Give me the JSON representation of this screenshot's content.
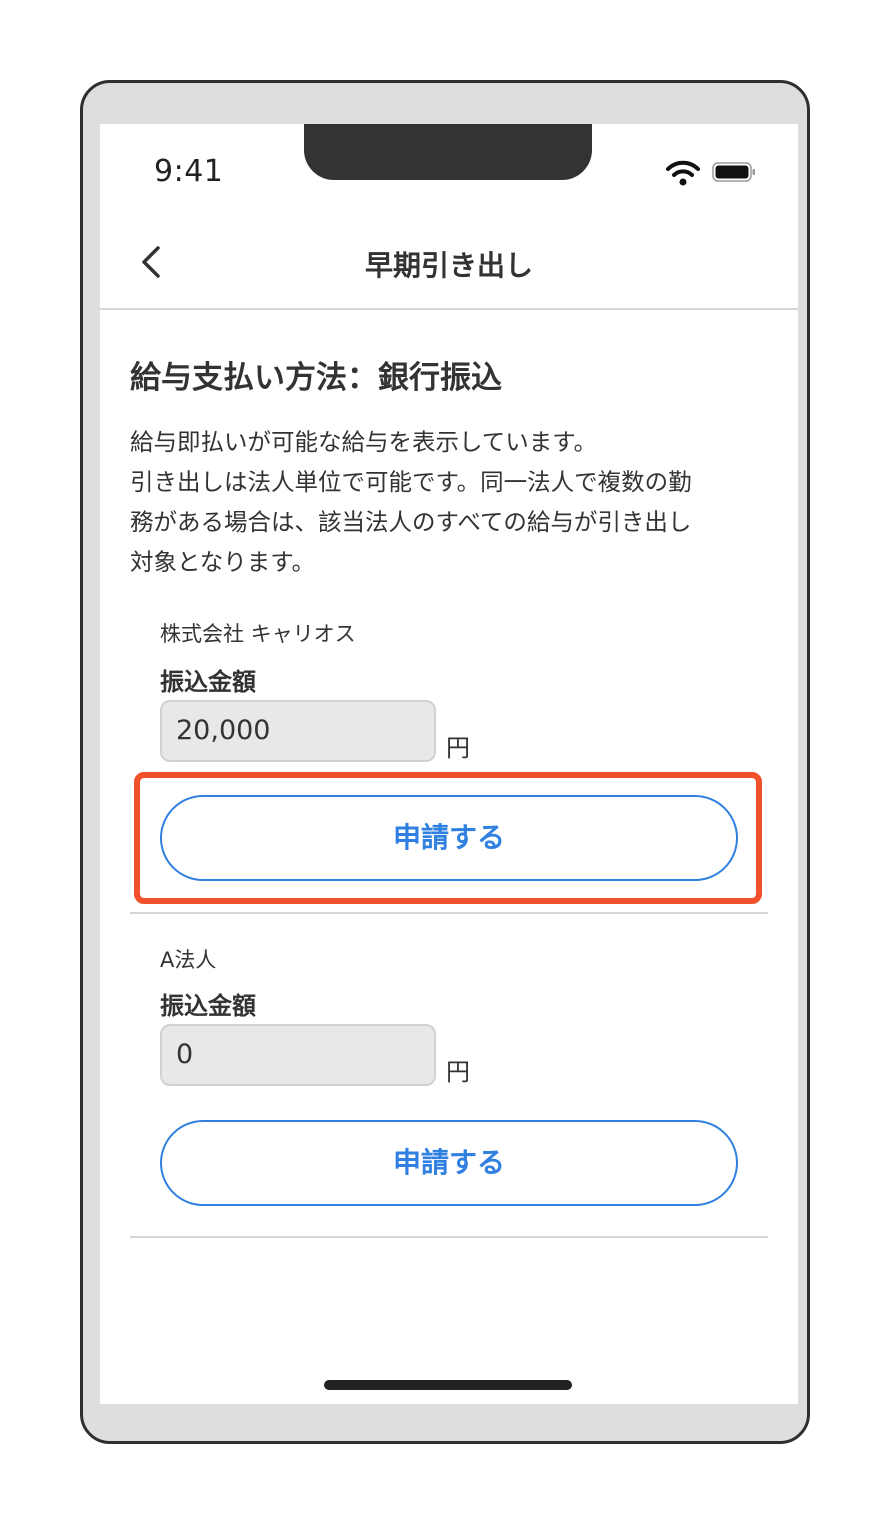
{
  "status_bar": {
    "time": "9:41",
    "wifi_icon": "wifi-icon",
    "battery_icon": "battery-icon"
  },
  "nav": {
    "title": "早期引き出し",
    "back_icon": "chevron-left-icon"
  },
  "content": {
    "heading": "給与支払い方法：銀行振込",
    "description_lines": [
      "給与即払いが可能な給与を表示しています。",
      "引き出しは法人単位で可能です。同一法人で複数の勤",
      "務がある場合は、該当法人のすべての給与が引き出し",
      "対象となります。"
    ],
    "entries": [
      {
        "company": "株式会社 キャリオス",
        "amount_label": "振込金額",
        "amount": "20,000",
        "unit": "円",
        "apply_label": "申請する"
      },
      {
        "company": "A法人",
        "amount_label": "振込金額",
        "amount": "0",
        "unit": "円",
        "apply_label": "申請する"
      }
    ]
  },
  "colors": {
    "accent": "#2f80e0",
    "highlight": "#f0502a",
    "field_bg": "#e8e8e8"
  }
}
